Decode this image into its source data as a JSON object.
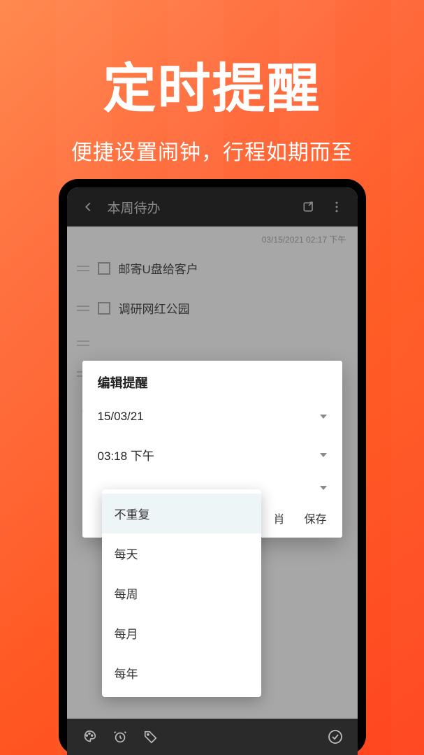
{
  "hero": {
    "title": "定时提醒",
    "subtitle": "便捷设置闹钟，行程如期而至"
  },
  "appbar": {
    "title": "本周待办"
  },
  "timestamp": "03/15/2021 02:17 下午",
  "todos": [
    {
      "text": "邮寄U盘给客户"
    },
    {
      "text": "调研网红公园"
    }
  ],
  "dialog": {
    "title": "编辑提醒",
    "date": "15/03/21",
    "time": "03:18 下午",
    "actions": {
      "cancel_partial": "肖",
      "save": "保存"
    }
  },
  "dropdown": {
    "items": [
      "不重复",
      "每天",
      "每周",
      "每月",
      "每年"
    ],
    "selected_index": 0
  },
  "icons": {
    "back": "back-arrow",
    "share": "share-icon",
    "overflow": "overflow-icon",
    "palette": "palette-icon",
    "alarm": "alarm-icon",
    "tag": "tag-icon",
    "check": "check-circle-icon"
  }
}
